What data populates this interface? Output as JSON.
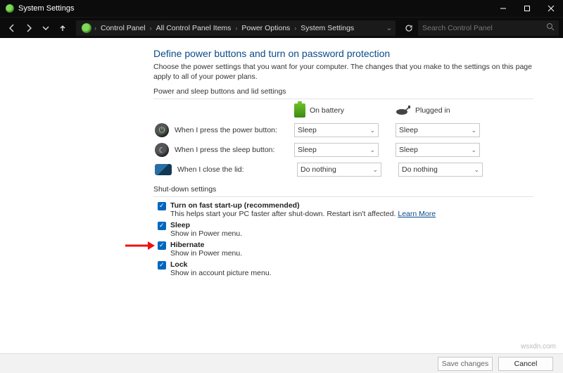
{
  "window": {
    "title": "System Settings"
  },
  "breadcrumb": {
    "items": [
      "Control Panel",
      "All Control Panel Items",
      "Power Options",
      "System Settings"
    ]
  },
  "search": {
    "placeholder": "Search Control Panel"
  },
  "page": {
    "heading": "Define power buttons and turn on password protection",
    "subtitle": "Choose the power settings that you want for your computer. The changes that you make to the settings on this page apply to all of your power plans.",
    "section1_label": "Power and sleep buttons and lid settings",
    "columns": {
      "battery": "On battery",
      "plugged": "Plugged in"
    },
    "rows": [
      {
        "label": "When I press the power button:",
        "battery": "Sleep",
        "plugged": "Sleep"
      },
      {
        "label": "When I press the sleep button:",
        "battery": "Sleep",
        "plugged": "Sleep"
      },
      {
        "label": "When I close the lid:",
        "battery": "Do nothing",
        "plugged": "Do nothing"
      }
    ],
    "section2_label": "Shut-down settings",
    "shutdown_items": [
      {
        "title": "Turn on fast start-up (recommended)",
        "desc": "This helps start your PC faster after shut-down. Restart isn't affected. ",
        "link": "Learn More"
      },
      {
        "title": "Sleep",
        "desc": "Show in Power menu."
      },
      {
        "title": "Hibernate",
        "desc": "Show in Power menu."
      },
      {
        "title": "Lock",
        "desc": "Show in account picture menu."
      }
    ]
  },
  "footer": {
    "save": "Save changes",
    "cancel": "Cancel"
  },
  "watermark": "wsxdn.com"
}
